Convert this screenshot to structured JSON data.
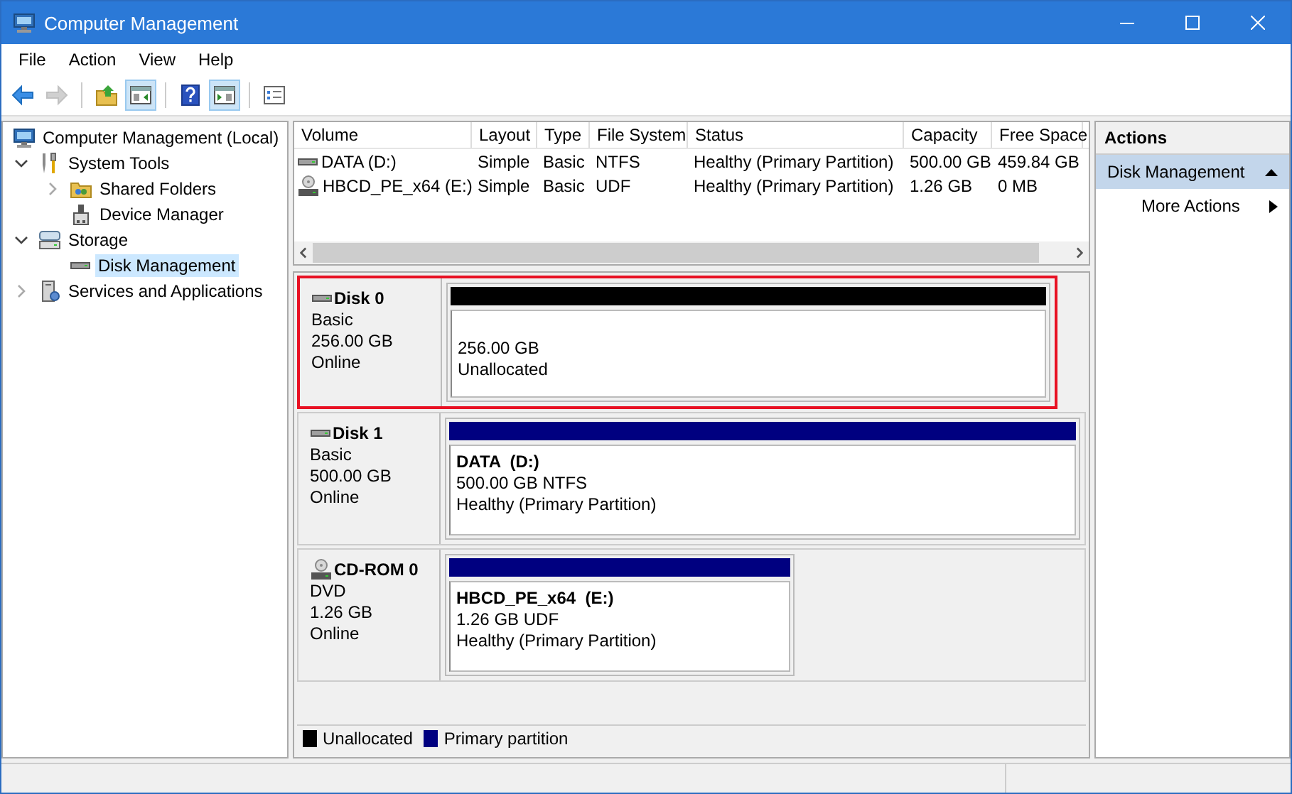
{
  "window": {
    "title": "Computer Management"
  },
  "menu": [
    "File",
    "Action",
    "View",
    "Help"
  ],
  "toolbar": [
    {
      "kind": "back",
      "disabled": false,
      "pressed": false
    },
    {
      "kind": "forward",
      "disabled": true,
      "pressed": false
    },
    {
      "kind": "up",
      "disabled": false,
      "pressed": false
    },
    {
      "kind": "tree-pane",
      "disabled": false,
      "pressed": true
    },
    {
      "kind": "help",
      "disabled": false,
      "pressed": false
    },
    {
      "kind": "action-pane",
      "disabled": false,
      "pressed": true
    },
    {
      "kind": "properties",
      "disabled": false,
      "pressed": false
    }
  ],
  "tree": [
    {
      "label": "Computer Management (Local)",
      "kind": "computer",
      "selected": false,
      "children": [
        {
          "label": "System Tools",
          "kind": "tools",
          "expanded": true,
          "selected": false,
          "children": [
            {
              "label": "Shared Folders",
              "kind": "shared",
              "expanded": false,
              "selected": false
            },
            {
              "label": "Device Manager",
              "kind": "device",
              "selected": false
            }
          ]
        },
        {
          "label": "Storage",
          "kind": "storage",
          "expanded": true,
          "selected": false,
          "children": [
            {
              "label": "Disk Management",
              "kind": "disk",
              "selected": true
            }
          ]
        },
        {
          "label": "Services and Applications",
          "kind": "services",
          "expanded": false,
          "selected": false
        }
      ]
    }
  ],
  "volume_list": {
    "columns": [
      "Volume",
      "Layout",
      "Type",
      "File System",
      "Status",
      "Capacity",
      "Free Space"
    ],
    "rows": [
      {
        "kind": "disk",
        "cells": [
          "DATA (D:)",
          "Simple",
          "Basic",
          "NTFS",
          "Healthy (Primary Partition)",
          "500.00 GB",
          "459.84 GB"
        ]
      },
      {
        "kind": "cdrom",
        "cells": [
          "HBCD_PE_x64 (E:)",
          "Simple",
          "Basic",
          "UDF",
          "Healthy (Primary Partition)",
          "1.26 GB",
          "0 MB"
        ]
      }
    ]
  },
  "disks": [
    {
      "kind": "disk",
      "name": "Disk 0",
      "lines": [
        "Basic",
        "256.00 GB",
        "Online"
      ],
      "highlighted": true,
      "partitions": [
        {
          "kind": "unallocated",
          "lines": [
            "256.00 GB",
            "Unallocated"
          ]
        }
      ]
    },
    {
      "kind": "disk",
      "name": "Disk 1",
      "lines": [
        "Basic",
        "500.00 GB",
        "Online"
      ],
      "highlighted": false,
      "partitions": [
        {
          "kind": "primary",
          "name": "DATA  (D:)",
          "lines": [
            "500.00 GB NTFS",
            "Healthy (Primary Partition)"
          ]
        }
      ]
    },
    {
      "kind": "cdrom",
      "name": "CD-ROM 0",
      "lines": [
        "DVD",
        "1.26 GB",
        "Online"
      ],
      "highlighted": false,
      "partitions": [
        {
          "kind": "primary",
          "name": "HBCD_PE_x64  (E:)",
          "lines": [
            "1.26 GB UDF",
            "Healthy (Primary Partition)"
          ]
        }
      ]
    }
  ],
  "legend": [
    {
      "label": "Unallocated",
      "color": "#000000"
    },
    {
      "label": "Primary partition",
      "color": "#000080"
    }
  ],
  "actions": {
    "title": "Actions",
    "sections": [
      {
        "label": "Disk Management",
        "expanded": true,
        "items": [
          "More Actions"
        ]
      }
    ]
  }
}
